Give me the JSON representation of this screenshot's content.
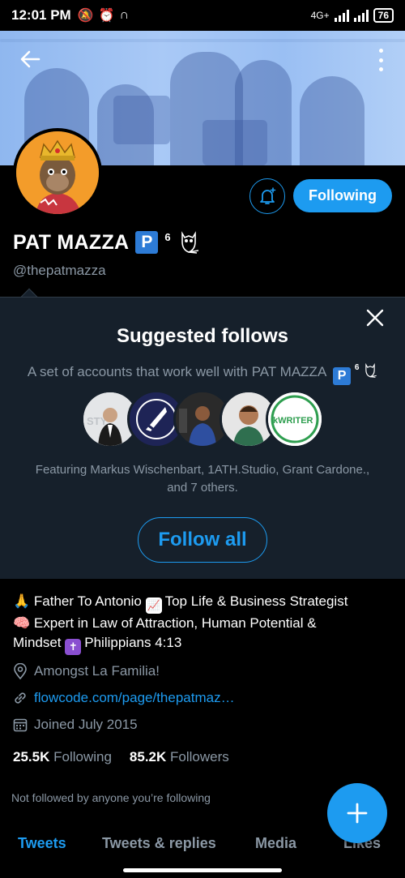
{
  "status": {
    "time": "12:01 PM",
    "network": "4G+",
    "battery": "76"
  },
  "profile": {
    "name": "PAT MAZZA",
    "badge_letter": "P",
    "superscript": "6",
    "handle": "@thepatmazza",
    "following_label": "Following"
  },
  "suggested": {
    "title": "Suggested follows",
    "description": "A set of accounts that work well with PAT MAZZA",
    "featuring_line1": "Featuring Markus Wischenbart, 1ATH.Studio, Grant Cardone.,",
    "featuring_line2": "and 7 others.",
    "follow_all_label": "Follow all",
    "avatar_texts": [
      "STY",
      "",
      "",
      "",
      "kWRITER"
    ]
  },
  "bio": {
    "line1_a": "Father To Antonio",
    "line1_b": "Top Life & Business Strategist",
    "line2": "Expert in Law of Attraction, Human Potential &",
    "line3_a": "Mindset",
    "line3_b": "Philippians 4:13"
  },
  "meta": {
    "location": "Amongst La Familia!",
    "link": "flowcode.com/page/thepatmaz…",
    "joined": "Joined July 2015"
  },
  "counts": {
    "following_value": "25.5K",
    "following_label": "Following",
    "followers_value": "85.2K",
    "followers_label": "Followers"
  },
  "not_followed": "Not followed by anyone you’re following",
  "tabs": [
    {
      "label": "Tweets"
    },
    {
      "label": "Tweets & replies"
    },
    {
      "label": "Media"
    },
    {
      "label": "Likes"
    }
  ],
  "colors": {
    "accent": "#1d9bf0",
    "panel": "#16202b",
    "muted": "#8b98a5"
  }
}
